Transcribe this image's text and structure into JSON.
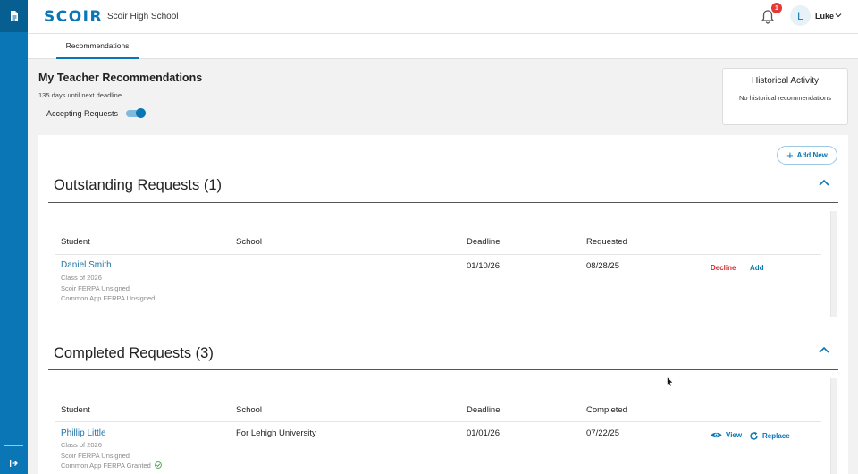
{
  "header": {
    "logo": "SCOIR",
    "school": "Scoir High School",
    "notification_count": "1",
    "avatar_initial": "L",
    "user_name": "Luke"
  },
  "tabs": [
    {
      "label": "Recommendations",
      "active": true
    }
  ],
  "page": {
    "title": "My Teacher Recommendations",
    "deadline_note": "135 days until next deadline",
    "accepting_label": "Accepting Requests",
    "accepting_enabled": true
  },
  "historical": {
    "title": "Historical Activity",
    "body": "No historical recommendations"
  },
  "add_new_label": "Add New",
  "outstanding": {
    "title": "Outstanding Requests (1)",
    "columns": [
      "Student",
      "School",
      "Deadline",
      "Requested"
    ],
    "rows": [
      {
        "student": "Daniel Smith",
        "class_of": "Class of 2026",
        "scoir_ferpa": "Scoir FERPA Unsigned",
        "commonapp_ferpa": "Common App FERPA Unsigned",
        "school": "",
        "deadline": "01/10/26",
        "requested": "08/28/25",
        "decline_label": "Decline",
        "add_label": "Add"
      }
    ]
  },
  "completed": {
    "title": "Completed Requests (3)",
    "columns": [
      "Student",
      "School",
      "Deadline",
      "Completed"
    ],
    "rows": [
      {
        "student": "Phillip Little",
        "class_of": "Class of 2026",
        "scoir_ferpa": "Scoir FERPA Unsigned",
        "commonapp_ferpa": "Common App FERPA Granted",
        "school": "For Lehigh University",
        "deadline": "01/01/26",
        "completed": "07/22/25",
        "view_label": "View",
        "replace_label": "Replace"
      }
    ]
  },
  "colors": {
    "brand": "#0a76b5",
    "rail_dark": "#075e91",
    "decline": "#d32f2f",
    "badge": "#e53935",
    "granted": "#43a047"
  }
}
